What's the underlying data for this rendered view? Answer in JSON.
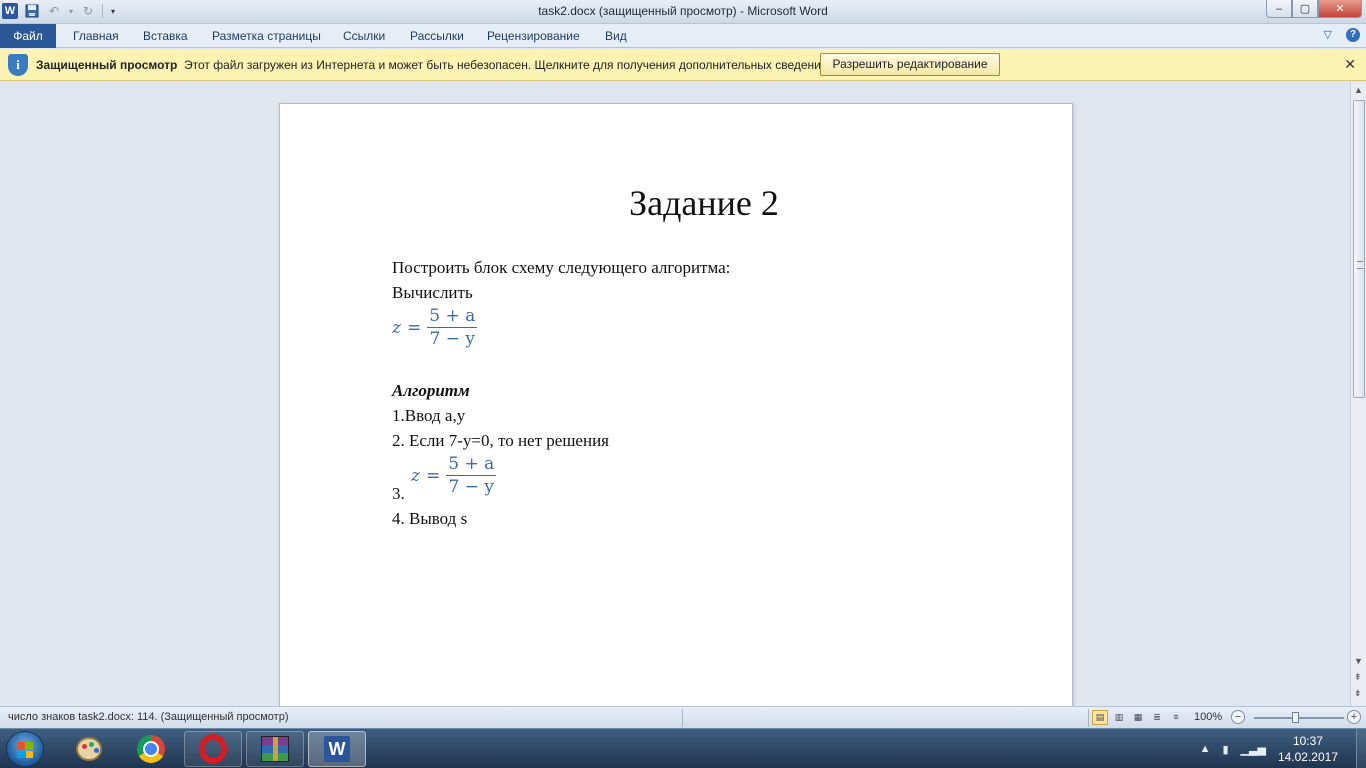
{
  "window": {
    "title": "task2.docx (защищенный просмотр)  -  Microsoft Word",
    "app_icon": "W",
    "buttons": {
      "minimize": "–",
      "maximize": "▢",
      "close": "✕"
    }
  },
  "qat": {
    "icons": [
      "word-logo-icon",
      "save-icon",
      "undo-icon",
      "redo-icon",
      "customize-icon"
    ]
  },
  "ribbon": {
    "tabs": [
      {
        "label": "Файл"
      },
      {
        "label": "Главная"
      },
      {
        "label": "Вставка"
      },
      {
        "label": "Разметка страницы"
      },
      {
        "label": "Ссылки"
      },
      {
        "label": "Рассылки"
      },
      {
        "label": "Рецензирование"
      },
      {
        "label": "Вид"
      }
    ],
    "right_icons": [
      "collapse-ribbon-icon",
      "help-icon"
    ]
  },
  "protected_bar": {
    "title": "Защищенный просмотр",
    "message": "Этот файл загружен из Интернета и может быть небезопасен. Щелкните для получения дополнительных сведений.",
    "enable_button": "Разрешить редактирование",
    "close": "✕",
    "color": "#fcf3b2"
  },
  "document": {
    "heading": "Задание 2",
    "task_line": "Построить блок схему следующего алгоритма:",
    "compute_line": "Вычислить",
    "formula": {
      "lhs": "z",
      "eq": "=",
      "numerator": "5 + a",
      "denominator": "7 − y"
    },
    "algorithm_title": "Алгоритм",
    "steps": [
      "1.Ввод a,y",
      "2. Если 7-y=0, то нет решения",
      "3.",
      "4. Вывод  s"
    ],
    "formula_color": "#3b6aa8"
  },
  "status_bar": {
    "text": "число знаков task2.docx: 114. (Защищенный просмотр)",
    "zoom": "100%",
    "zoom_minus": "−",
    "zoom_plus": "+"
  },
  "taskbar": {
    "apps": [
      "paint-icon",
      "chrome-icon",
      "opera-icon",
      "winrar-icon",
      "word-icon"
    ],
    "time": "10:37",
    "date": "14.02.2017"
  }
}
